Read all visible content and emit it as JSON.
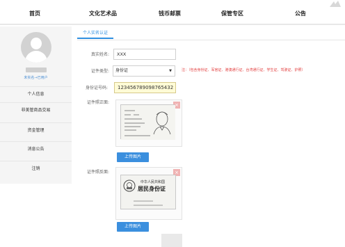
{
  "nav": {
    "items": [
      "首页",
      "文化艺术品",
      "钱币邮票",
      "保管专区",
      "公告"
    ]
  },
  "sidebar": {
    "status": "未实名→已用户",
    "menu": [
      "个人信息",
      "非美管商品交易",
      "资金管理",
      "消息公告",
      "注销"
    ]
  },
  "main": {
    "tab_label": "个人实名认证",
    "real_name_label": "真实姓名:",
    "real_name_value": "XXX",
    "id_type_label": "证件类型:",
    "id_type_value": "身份证",
    "id_type_note": "注：（包含身份证、军官证、港澳通行证、台湾通行证、学生证、驾驶证、护照）",
    "id_number_label": "身份证号码:",
    "id_number_value": "123456789098765432",
    "front_label": "证件照正面:",
    "back_label": "证件照反面:",
    "upload_label": "上传图片",
    "close_symbol": "×"
  },
  "idcard_back": {
    "line1": "中华人民共和国",
    "line2": "居民身份证"
  },
  "colors": {
    "accent": "#2f8fe0",
    "note_red": "#e23b3b",
    "highlight_input": "#fffbd6"
  },
  "icons": {
    "avatar": "avatar-placeholder-icon",
    "close": "close-icon",
    "emblem": "national-emblem-icon"
  }
}
